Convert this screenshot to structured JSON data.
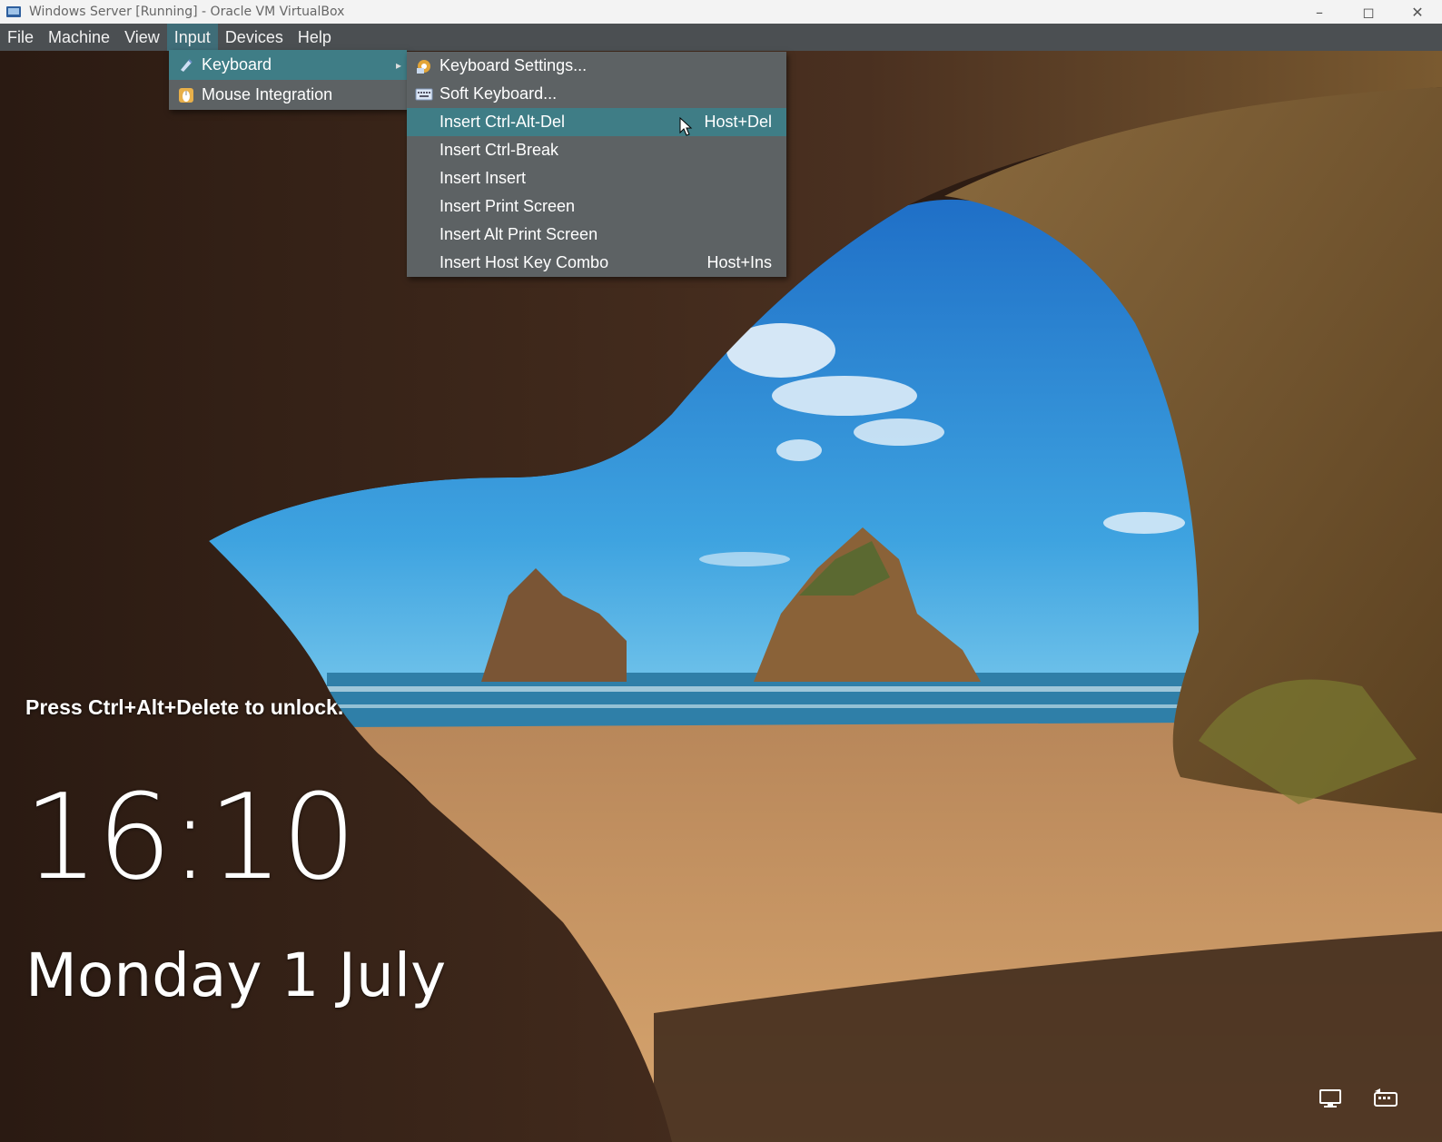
{
  "window": {
    "title": "Windows Server [Running] - Oracle VM VirtualBox",
    "controls": [
      "minimize-icon",
      "maximize-icon",
      "close-icon"
    ]
  },
  "menubar": {
    "items": [
      {
        "label": "File"
      },
      {
        "label": "Machine"
      },
      {
        "label": "View"
      },
      {
        "label": "Input",
        "active": true
      },
      {
        "label": "Devices"
      },
      {
        "label": "Help"
      }
    ]
  },
  "input_menu": {
    "items": [
      {
        "label": "Keyboard",
        "icon": "keyboard-pen-icon",
        "has_submenu": true,
        "highlighted": true
      },
      {
        "label": "Mouse Integration",
        "icon": "mouse-integration-icon"
      }
    ]
  },
  "keyboard_submenu": {
    "items": [
      {
        "label": "Keyboard Settings...",
        "icon": "keyboard-settings-icon"
      },
      {
        "label": "Soft Keyboard...",
        "icon": "soft-keyboard-icon"
      },
      {
        "label": "Insert Ctrl-Alt-Del",
        "shortcut": "Host+Del",
        "highlighted": true
      },
      {
        "label": "Insert Ctrl-Break"
      },
      {
        "label": "Insert Insert"
      },
      {
        "label": "Insert Print Screen"
      },
      {
        "label": "Insert Alt Print Screen"
      },
      {
        "label": "Insert Host Key Combo",
        "shortcut": "Host+Ins"
      }
    ]
  },
  "lockscreen": {
    "unlock_hint": "Press Ctrl+Alt+Delete to unlock.",
    "time": "16:10",
    "date": "Monday 1 July"
  },
  "status_icons": [
    "network-icon",
    "keyboard-capture-icon"
  ],
  "colors": {
    "menu_bg": "#5d6264",
    "highlight": "#3f7d86",
    "menubar_bg": "#4b4f52"
  }
}
